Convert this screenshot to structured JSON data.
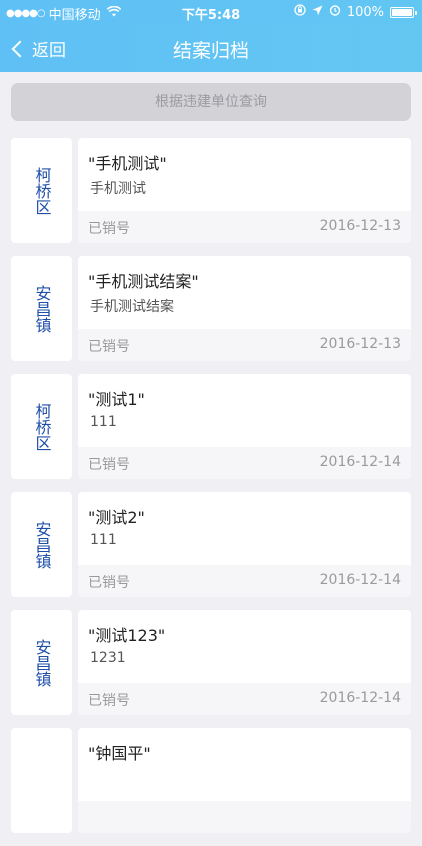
{
  "status_bar": {
    "signal_dots": "●●●●○",
    "carrier": "中国移动",
    "time": "下午5:48",
    "battery": "100%"
  },
  "nav": {
    "back_label": "返回",
    "title": "结案归档"
  },
  "search": {
    "label": "根据违建单位查询"
  },
  "items": [
    {
      "region": "柯桥区",
      "title": "\"手机测试\"",
      "subtitle": "手机测试",
      "status": "已销号",
      "date": "2016-12-13"
    },
    {
      "region": "安昌镇",
      "title": "\"手机测试结案\"",
      "subtitle": "手机测试结案",
      "status": "已销号",
      "date": "2016-12-13"
    },
    {
      "region": "柯桥区",
      "title": "\"测试1\"",
      "subtitle": "111",
      "status": "已销号",
      "date": "2016-12-14"
    },
    {
      "region": "安昌镇",
      "title": "\"测试2\"",
      "subtitle": "111",
      "status": "已销号",
      "date": "2016-12-14"
    },
    {
      "region": "安昌镇",
      "title": "\"测试123\"",
      "subtitle": "1231",
      "status": "已销号",
      "date": "2016-12-14"
    },
    {
      "region": "",
      "title": "\"钟国平\"",
      "subtitle": "",
      "status": "",
      "date": ""
    }
  ]
}
